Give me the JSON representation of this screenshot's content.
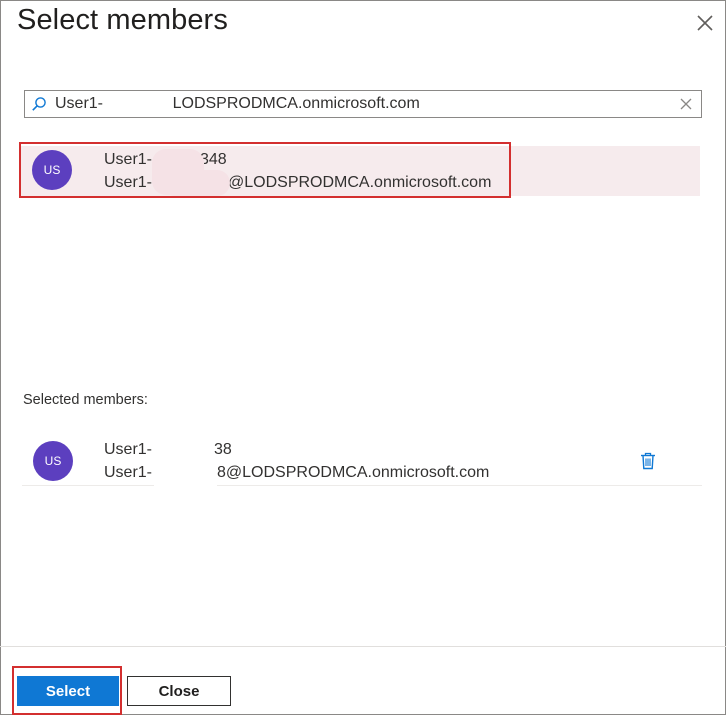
{
  "dialog": {
    "title": "Select members"
  },
  "search": {
    "value": "User1-          8@LODSPRODMCA.onmicrosoft.com"
  },
  "results": [
    {
      "avatar_initials": "US",
      "name_visible_start": "User1-",
      "name_visible_end": "348",
      "email_visible_start": "User1-",
      "email_visible_end": "@LODSPRODMCA.onmicrosoft.com"
    }
  ],
  "selected": {
    "label": "Selected members:",
    "items": [
      {
        "avatar_initials": "US",
        "name_visible_start": "User1-",
        "name_visible_end": "38",
        "email_visible_start": "User1-",
        "email_visible_end": "8@LODSPRODMCA.onmicrosoft.com"
      }
    ]
  },
  "footer": {
    "select_label": "Select",
    "close_label": "Close"
  },
  "colors": {
    "avatar": "#5c3fbf",
    "primary_button": "#0f78d4",
    "highlight_outline": "#d32f2f",
    "selected_row_bg": "#f6ebed",
    "trash_icon": "#0f78d4"
  },
  "icons": {
    "close": "close-icon",
    "search": "search-icon",
    "clear": "clear-icon",
    "delete": "trash-icon"
  }
}
